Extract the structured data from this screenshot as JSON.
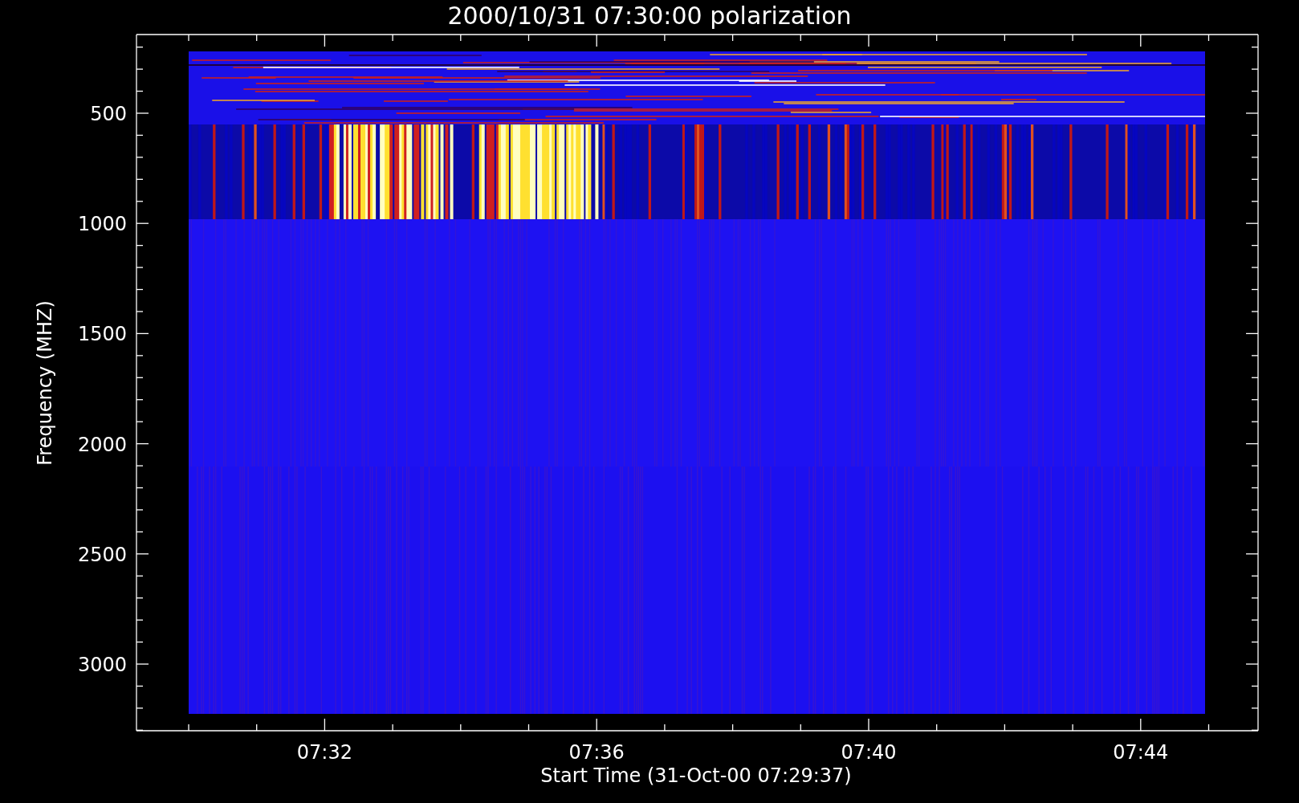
{
  "title": "2000/10/31 07:30:00 polarization",
  "y_axis": {
    "label": "Frequency (MHZ)",
    "tick_labels": [
      "500",
      "1000",
      "1500",
      "2000",
      "2500",
      "3000"
    ]
  },
  "x_axis": {
    "label": "Start Time (31-Oct-00 07:29:37)",
    "tick_labels": [
      "07:32",
      "07:36",
      "07:40",
      "07:44"
    ]
  }
}
